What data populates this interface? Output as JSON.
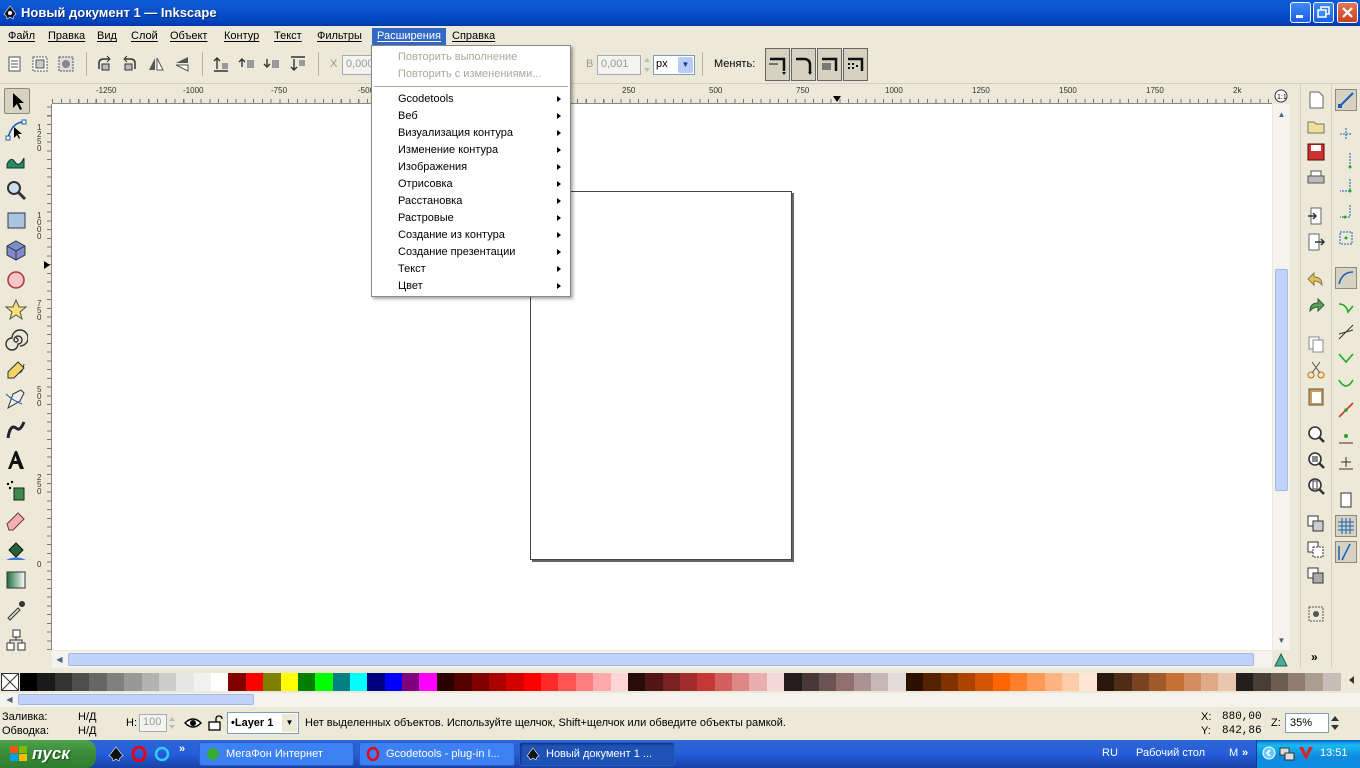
{
  "window": {
    "title": "Новый документ 1 — Inkscape"
  },
  "menubar": [
    "Файл",
    "Правка",
    "Вид",
    "Слой",
    "Объект",
    "Контур",
    "Текст",
    "Фильтры",
    "Расширения",
    "Справка"
  ],
  "extensions_menu": {
    "disabled_items": [
      "Повторить выполнение",
      "Повторить с изменениями..."
    ],
    "items": [
      "Gcodetools",
      "Веб",
      "Визуализация контура",
      "Изменение контура",
      "Изображения",
      "Отрисовка",
      "Расстановка",
      "Растровые",
      "Создание из контура",
      "Создание презентации",
      "Текст",
      "Цвет"
    ]
  },
  "toolbar": {
    "x_label": "X",
    "x_value": "0,000",
    "w_label": "В",
    "w_value": "0,001",
    "units": "px",
    "change_label": "Менять:"
  },
  "rulers": {
    "h_labels": [
      "-1250",
      "-1000",
      "-750",
      "-500",
      "250",
      "500",
      "750",
      "1000",
      "1250",
      "1500",
      "1750",
      "2k"
    ],
    "v_labels": [
      "1250",
      "1000",
      "750",
      "500",
      "250",
      "0"
    ]
  },
  "status": {
    "fill_label": "Заливка:",
    "fill_value": "Н/Д",
    "stroke_label": "Обводка:",
    "stroke_value": "Н/Д",
    "opacity_label": "H:",
    "opacity_value": "100",
    "layer": "•Layer 1",
    "message": "Нет выделенных объектов. Используйте щелчок, Shift+щелчок или обведите объекты рамкой.",
    "x_label": "X:",
    "x_value": "880,00",
    "y_label": "Y:",
    "y_value": "842,86",
    "zoom_label": "Z:",
    "zoom_value": "35%"
  },
  "taskbar": {
    "start": "пуск",
    "tasks": [
      "МегаФон Интернет",
      "Gcodetools - plug-in I...",
      "Новый документ 1 ..."
    ],
    "lang": "RU",
    "desktop": "Рабочий стол",
    "m_label": "M",
    "clock": "13:51"
  },
  "palette_colors": [
    "#000000",
    "#1a1a1a",
    "#333333",
    "#4d4d4d",
    "#666666",
    "#808080",
    "#999999",
    "#b3b3b3",
    "#cccccc",
    "#e6e6e6",
    "#f2f2f2",
    "#ffffff",
    "#800000",
    "#ff0000",
    "#808000",
    "#ffff00",
    "#008000",
    "#00ff00",
    "#008080",
    "#00ffff",
    "#000080",
    "#0000ff",
    "#800080",
    "#ff00ff",
    "#2b0000",
    "#550000",
    "#800000",
    "#aa0000",
    "#d40000",
    "#ff0000",
    "#ff2a2a",
    "#ff5555",
    "#ff8080",
    "#ffaaaa",
    "#ffd5d5",
    "#280b0b",
    "#501616",
    "#782121",
    "#a02c2c",
    "#c83737",
    "#d35f5f",
    "#de8787",
    "#e9afaf",
    "#f4d7d7",
    "#241c1c",
    "#483737",
    "#6c5353",
    "#916f6f",
    "#ac9393",
    "#c8b7b7",
    "#e3dbdb",
    "#2b1100",
    "#552200",
    "#803300",
    "#aa4400",
    "#d45500",
    "#ff6600",
    "#ff7f2a",
    "#ff9955",
    "#ffb380",
    "#ffccaa",
    "#ffe6d5",
    "#28170b",
    "#502d16",
    "#784421",
    "#a05a2c",
    "#c87137",
    "#d38d5f",
    "#deaa87",
    "#e9c6af",
    "#241f1c",
    "#483e37",
    "#6c5d53",
    "#917c6f",
    "#ac9d93",
    "#c8beb7"
  ]
}
